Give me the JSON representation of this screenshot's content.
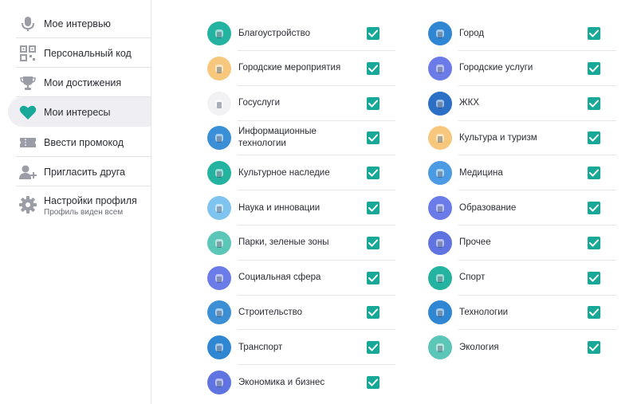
{
  "sidebar": {
    "items": [
      {
        "label": "Мое интервью",
        "icon": "microphone-icon",
        "active": false
      },
      {
        "label": "Персональный код",
        "icon": "qr-code-icon",
        "active": false
      },
      {
        "label": "Мои достижения",
        "icon": "trophy-icon",
        "active": false
      },
      {
        "label": "Мои интересы",
        "icon": "heart-icon",
        "active": true
      },
      {
        "label": "Ввести промокод",
        "icon": "ticket-icon",
        "active": false
      },
      {
        "label": "Пригласить друга",
        "icon": "add-user-icon",
        "active": false
      },
      {
        "label": "Настройки профиля",
        "sub": "Профиль виден всем",
        "icon": "gear-icon",
        "active": false
      }
    ],
    "icon_color": "#9a9ca6",
    "active_color": "#17a898"
  },
  "interests": {
    "left": [
      {
        "label": "Благоустройство",
        "icon": "tree-icon",
        "bg": "#23b3a0",
        "checked": true
      },
      {
        "label": "Городские мероприятия",
        "icon": "play-icon",
        "bg": "#f6c77d",
        "checked": true
      },
      {
        "label": "Госуслуги",
        "icon": "flag-icon",
        "bg": "#f2f2f4",
        "checked": true
      },
      {
        "label": "Информационные технологии",
        "icon": "monitor-icon",
        "bg": "#3a8fd6",
        "checked": true
      },
      {
        "label": "Культурное наследие",
        "icon": "column-icon",
        "bg": "#23b3a0",
        "checked": true
      },
      {
        "label": "Наука и инновации",
        "icon": "flask-icon",
        "bg": "#7fc4ee",
        "checked": true
      },
      {
        "label": "Парки, зеленые зоны",
        "icon": "tree-icon",
        "bg": "#5cc6b8",
        "checked": true
      },
      {
        "label": "Социальная сфера",
        "icon": "heart-icon",
        "bg": "#6b7ce8",
        "checked": true
      },
      {
        "label": "Строительство",
        "icon": "bricks-icon",
        "bg": "#3c8fd4",
        "checked": true
      },
      {
        "label": "Транспорт",
        "icon": "bus-icon",
        "bg": "#2f86d2",
        "checked": true
      },
      {
        "label": "Экономика и бизнес",
        "icon": "calculator-icon",
        "bg": "#5f74e0",
        "checked": true
      }
    ],
    "right": [
      {
        "label": "Город",
        "icon": "building-icon",
        "bg": "#2f86d2",
        "checked": true
      },
      {
        "label": "Городские услуги",
        "icon": "bag-icon",
        "bg": "#6b7ce8",
        "checked": true
      },
      {
        "label": "ЖКХ",
        "icon": "house-icon",
        "bg": "#2b6fc6",
        "checked": true
      },
      {
        "label": "Культура и туризм",
        "icon": "umbrella-icon",
        "bg": "#f6c77d",
        "checked": true
      },
      {
        "label": "Медицина",
        "icon": "pill-icon",
        "bg": "#4b9be4",
        "checked": true
      },
      {
        "label": "Образование",
        "icon": "graduation-cap-icon",
        "bg": "#6b7ce8",
        "checked": true
      },
      {
        "label": "Прочее",
        "icon": "document-icon",
        "bg": "#5f74e0",
        "checked": true
      },
      {
        "label": "Спорт",
        "icon": "ball-icon",
        "bg": "#23b3a0",
        "checked": true
      },
      {
        "label": "Технологии",
        "icon": "router-icon",
        "bg": "#2f86d2",
        "checked": true
      },
      {
        "label": "Экология",
        "icon": "leaf-icon",
        "bg": "#5cc6b8",
        "checked": true
      }
    ],
    "check_color": "#17a898"
  }
}
